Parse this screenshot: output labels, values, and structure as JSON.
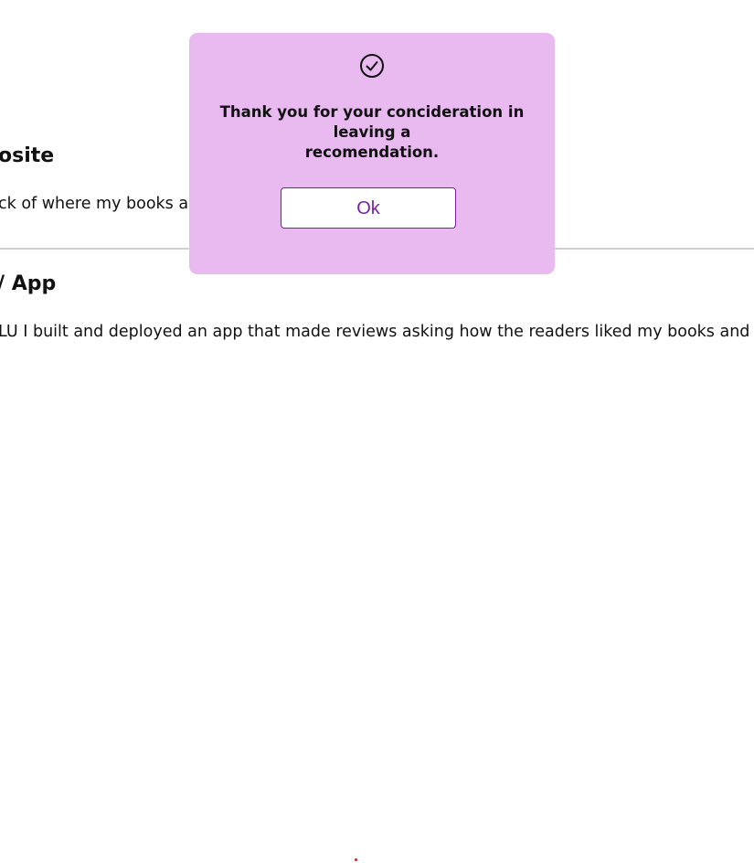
{
  "sections": [
    {
      "title": "osite",
      "body": "ck of where my books ar                                                                    are being sold."
    },
    {
      "title": "/ App",
      "body": "LU I built and deployed an app that made reviews asking how the readers liked my books and"
    }
  ],
  "modal": {
    "icon": "check-circle-icon",
    "message": "Thank you for your conciderationin leaving a recomendation.",
    "message_line1": "Thank you for your concideration in leaving a",
    "message_line2": "recomendation.",
    "ok_label": "Ok"
  },
  "colors": {
    "modal_background": "#e8baf0",
    "button_accent": "#7a1fa2"
  }
}
